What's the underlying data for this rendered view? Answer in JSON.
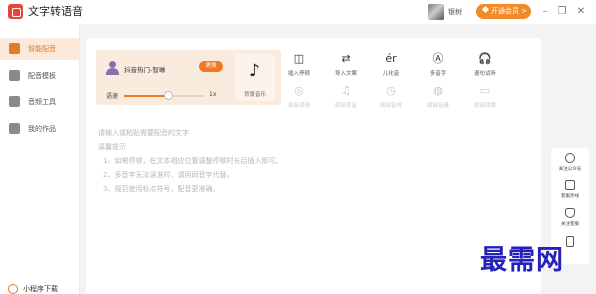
{
  "window": {
    "title": "文字转语音",
    "user_name": "银树",
    "vip_label": "开通会员 >",
    "min_glyph": "–",
    "max_glyph": "❐",
    "close_glyph": "✕"
  },
  "sidebar": {
    "items": [
      {
        "label": "智能配音",
        "active": true
      },
      {
        "label": "配音模板",
        "active": false
      },
      {
        "label": "音频工具",
        "active": false
      },
      {
        "label": "我的作品",
        "active": false
      }
    ],
    "mini_program": "小程序下载"
  },
  "voice": {
    "speaker": "抖音热门-智琳",
    "change_label": "更换",
    "speed_label": "语速",
    "speed_value": "1x",
    "speed_fraction": 0.55,
    "bgm_label": "背景音乐",
    "bgm_icon": "music-note-icon"
  },
  "tools": [
    {
      "label": "插入停顿",
      "icon": "pause-insert-icon",
      "glyph": "◫",
      "enabled": true
    },
    {
      "label": "导入文案",
      "icon": "import-text-icon",
      "glyph": "⇄",
      "enabled": true
    },
    {
      "label": "儿化音",
      "icon": "erhua-icon",
      "glyph": "ér",
      "enabled": true
    },
    {
      "label": "多音字",
      "icon": "polyphone-icon",
      "glyph": "Ⓐ",
      "enabled": true
    },
    {
      "label": "退句试听",
      "icon": "headphones-icon",
      "glyph": "🎧",
      "enabled": true
    },
    {
      "label": "局部调速",
      "icon": "local-speed-icon",
      "glyph": "◎",
      "enabled": false
    },
    {
      "label": "局部变音",
      "icon": "local-voice-icon",
      "glyph": "♫",
      "enabled": false
    },
    {
      "label": "局部音效",
      "icon": "local-effect-icon",
      "glyph": "◷",
      "enabled": false
    },
    {
      "label": "局部音量",
      "icon": "local-volume-icon",
      "glyph": "◍",
      "enabled": false
    },
    {
      "label": "局部转换",
      "icon": "local-switch-icon",
      "glyph": "▭",
      "enabled": false
    }
  ],
  "editor": {
    "placeholder": "请输入或粘贴需要配音的文字",
    "tips_title": "温馨提示",
    "tips": [
      "1、如需停顿，在文本相应位置调整停顿时长后插入即可。",
      "2、多音字无法读准时，请用同音字代替。",
      "3、规范使用标点符号，配音更准确。"
    ]
  },
  "float_panel": [
    {
      "label": "关注公众号",
      "icon": "chat-icon"
    },
    {
      "label": "客服热线",
      "icon": "phone-icon"
    },
    {
      "label": "关注客服",
      "icon": "support-icon"
    },
    {
      "label": "",
      "icon": "mobile-icon"
    }
  ],
  "watermark": "最需网",
  "colors": {
    "accent": "#f07a24",
    "active_bg": "#fbe9dc",
    "watermark": "#2422b8"
  }
}
